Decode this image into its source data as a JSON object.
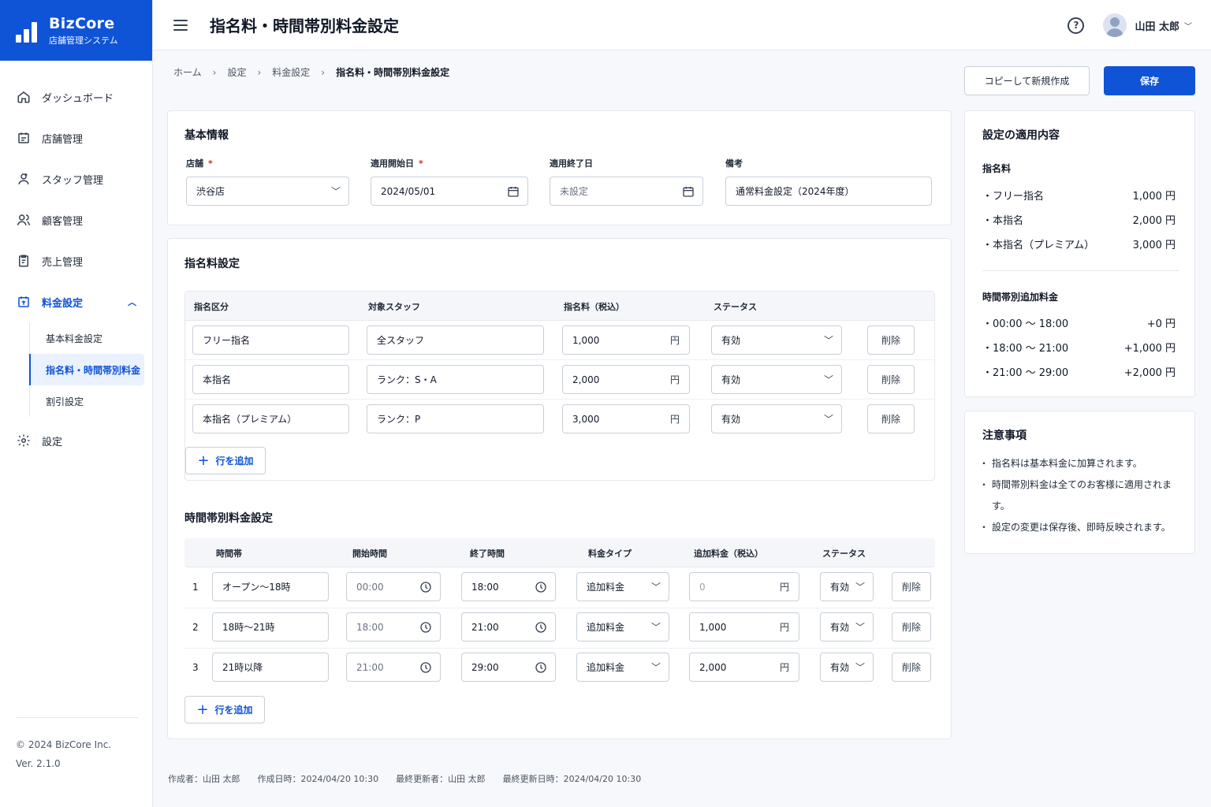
{
  "brand": {
    "name": "BizCore",
    "sub": "店舗管理システム"
  },
  "nav": {
    "items": [
      {
        "label": "ダッシュボード"
      },
      {
        "label": "店舗管理"
      },
      {
        "label": "スタッフ管理"
      },
      {
        "label": "顧客管理"
      },
      {
        "label": "売上管理"
      },
      {
        "label": "料金設定"
      },
      {
        "label": "設定"
      }
    ],
    "sub": [
      {
        "label": "基本料金設定"
      },
      {
        "label": "指名料・時間帯別料金"
      },
      {
        "label": "割引設定"
      }
    ]
  },
  "footer_side": {
    "copyright": "© 2024 BizCore Inc.",
    "version": "Ver. 2.1.0"
  },
  "header": {
    "title": "指名料・時間帯別料金設定",
    "help": "?",
    "user": "山田 太郎"
  },
  "breadcrumb": [
    "ホーム",
    "設定",
    "料金設定",
    "指名料・時間帯別料金設定"
  ],
  "actions": {
    "copy": "コピーして新規作成",
    "save": "保存"
  },
  "basic": {
    "title": "基本情報",
    "required_mark": "*",
    "store_label": "店舗",
    "store_value": "渋谷店",
    "start_label": "適用開始日",
    "start_value": "2024/05/01",
    "end_label": "適用終了日",
    "end_value": "未設定",
    "note_label": "備考",
    "note_value": "通常料金設定（2024年度）"
  },
  "nomination": {
    "title": "指名料設定",
    "headers": [
      "指名区分",
      "対象スタッフ",
      "指名料（税込）",
      "ステータス"
    ],
    "unit": "円",
    "delete": "削除",
    "add": "行を追加",
    "rows": [
      {
        "type": "フリー指名",
        "staff": "全スタッフ",
        "fee": "1,000",
        "status": "有効"
      },
      {
        "type": "本指名",
        "staff": "ランク：S・A",
        "fee": "2,000",
        "status": "有効"
      },
      {
        "type": "本指名（プレミアム）",
        "staff": "ランク：P",
        "fee": "3,000",
        "status": "有効"
      }
    ]
  },
  "timeband": {
    "title": "時間帯別料金設定",
    "headers": [
      "時間帯",
      "開始時間",
      "終了時間",
      "料金タイプ",
      "追加料金（税込）",
      "ステータス"
    ],
    "unit": "円",
    "delete": "削除",
    "add": "行を追加",
    "rows": [
      {
        "no": "1",
        "name": "オープン〜18時",
        "start": "00:00",
        "end": "18:00",
        "type": "追加料金",
        "fee": "0",
        "status": "有効"
      },
      {
        "no": "2",
        "name": "18時〜21時",
        "start": "18:00",
        "end": "21:00",
        "type": "追加料金",
        "fee": "1,000",
        "status": "有効"
      },
      {
        "no": "3",
        "name": "21時以降",
        "start": "21:00",
        "end": "29:00",
        "type": "追加料金",
        "fee": "2,000",
        "status": "有効"
      }
    ]
  },
  "summary": {
    "title": "設定の適用内容",
    "nom_title": "指名料",
    "nom": [
      {
        "label": "・フリー指名",
        "value": "1,000 円"
      },
      {
        "label": "・本指名",
        "value": "2,000 円"
      },
      {
        "label": "・本指名（プレミアム）",
        "value": "3,000 円"
      }
    ],
    "time_title": "時間帯別追加料金",
    "time": [
      {
        "label": "・00:00 〜 18:00",
        "value": "+0 円"
      },
      {
        "label": "・18:00 〜 21:00",
        "value": "+1,000 円"
      },
      {
        "label": "・21:00 〜 29:00",
        "value": "+2,000 円"
      }
    ]
  },
  "notes": {
    "title": "注意事項",
    "items": [
      "指名料は基本料金に加算されます。",
      "時間帯別料金は全てのお客様に適用されます。",
      "設定の変更は保存後、即時反映されます。"
    ]
  },
  "audit": {
    "created_by": "作成者：山田 太郎",
    "created_at": "作成日時：2024/04/20 10:30",
    "updated_by": "最終更新者：山田 太郎",
    "updated_at": "最終更新日時：2024/04/20 10:30"
  }
}
